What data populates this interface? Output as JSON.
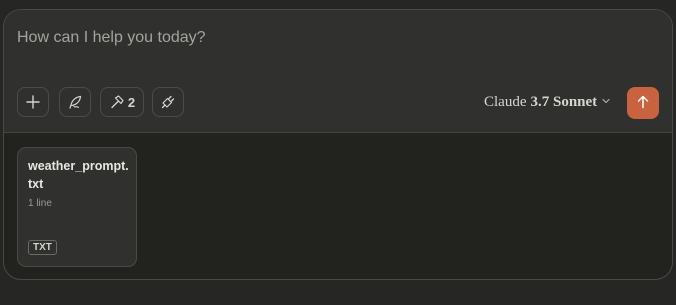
{
  "composer": {
    "placeholder": "How can I help you today?",
    "value": ""
  },
  "toolbar": {
    "add_icon": "plus-icon",
    "style_icon": "quill-icon",
    "tools_icon": "hammer-icon",
    "tools_count": "2",
    "integrations_icon": "plug-icon"
  },
  "model_selector": {
    "name": "Claude",
    "version": "3.7 Sonnet",
    "icon": "chevron-down-icon"
  },
  "send": {
    "icon": "arrow-up-icon",
    "color": "#c9633f"
  },
  "attachments": [
    {
      "file_name": "weather_prompt.txt",
      "meta": "1 line",
      "type": "TXT"
    }
  ]
}
